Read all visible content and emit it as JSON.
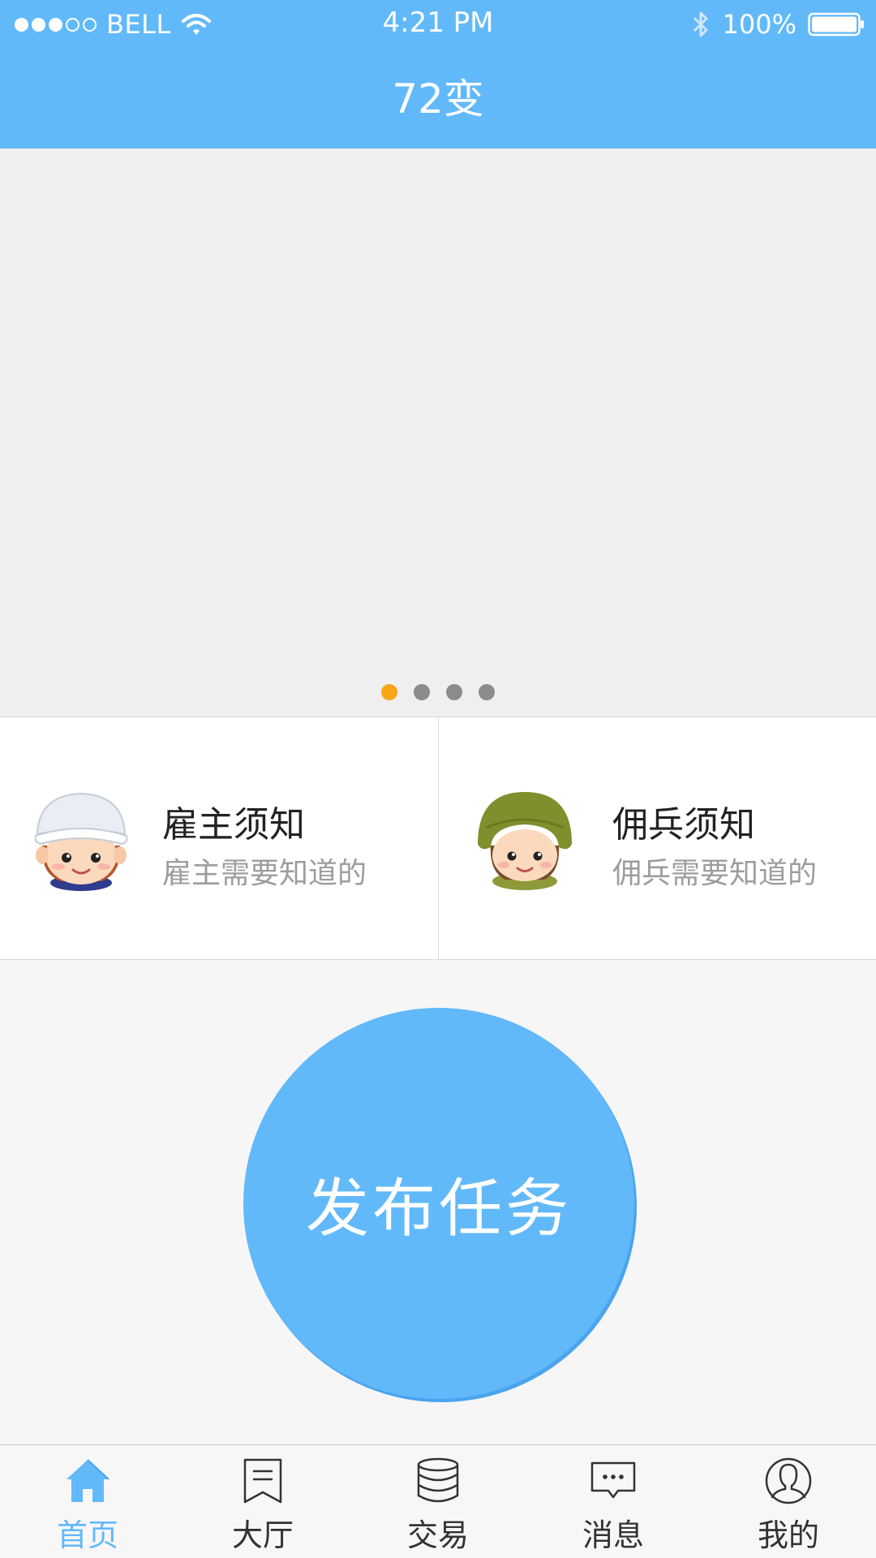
{
  "status_bar": {
    "carrier": "BELL",
    "time": "4:21 PM",
    "battery": "100%",
    "signal_bars_filled": 3,
    "signal_bars_total": 5
  },
  "header": {
    "title": "72变"
  },
  "banner": {
    "page_count": 4,
    "active_page": 1
  },
  "cards": [
    {
      "title": "雇主须知",
      "subtitle": "雇主需要知道的",
      "icon": "employer-avatar-icon"
    },
    {
      "title": "佣兵须知",
      "subtitle": "佣兵需要知道的",
      "icon": "mercenary-avatar-icon"
    }
  ],
  "publish": {
    "label": "发布任务"
  },
  "tabs": [
    {
      "label": "首页",
      "icon": "home-icon",
      "active": true
    },
    {
      "label": "大厅",
      "icon": "bookmark-icon",
      "active": false
    },
    {
      "label": "交易",
      "icon": "database-icon",
      "active": false
    },
    {
      "label": "消息",
      "icon": "chat-icon",
      "active": false
    },
    {
      "label": "我的",
      "icon": "profile-icon",
      "active": false
    }
  ],
  "colors": {
    "primary": "#61b9fa",
    "pager_active": "#f9a51a",
    "pager_inactive": "#8c8c8c",
    "subtitle": "#9d9d9d"
  }
}
